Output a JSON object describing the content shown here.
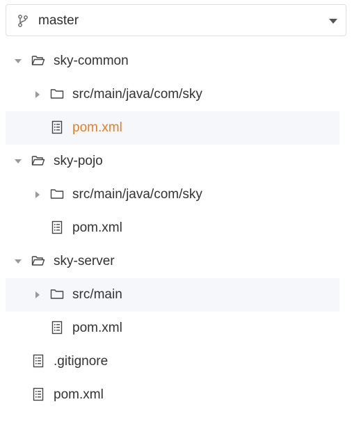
{
  "branch": {
    "name": "master",
    "icon": "git-branch-icon"
  },
  "colors": {
    "active_text": "#e67e22",
    "text": "#333333",
    "highlight_bg": "#f5f7fa",
    "border": "#dcdfe6"
  },
  "tree": [
    {
      "label": "sky-common",
      "type": "folder",
      "expanded": true,
      "selected": false
    },
    {
      "label": "src/main/java/com/sky",
      "type": "folder",
      "expanded": false,
      "selected": false
    },
    {
      "label": "pom.xml",
      "type": "file",
      "selected": true
    },
    {
      "label": "sky-pojo",
      "type": "folder",
      "expanded": true,
      "selected": false
    },
    {
      "label": "src/main/java/com/sky",
      "type": "folder",
      "expanded": false,
      "selected": false
    },
    {
      "label": "pom.xml",
      "type": "file",
      "selected": false
    },
    {
      "label": "sky-server",
      "type": "folder",
      "expanded": true,
      "selected": false
    },
    {
      "label": "src/main",
      "type": "folder",
      "expanded": false,
      "selected": false
    },
    {
      "label": "pom.xml",
      "type": "file",
      "selected": false
    },
    {
      "label": ".gitignore",
      "type": "file",
      "selected": false
    },
    {
      "label": "pom.xml",
      "type": "file",
      "selected": false
    }
  ]
}
